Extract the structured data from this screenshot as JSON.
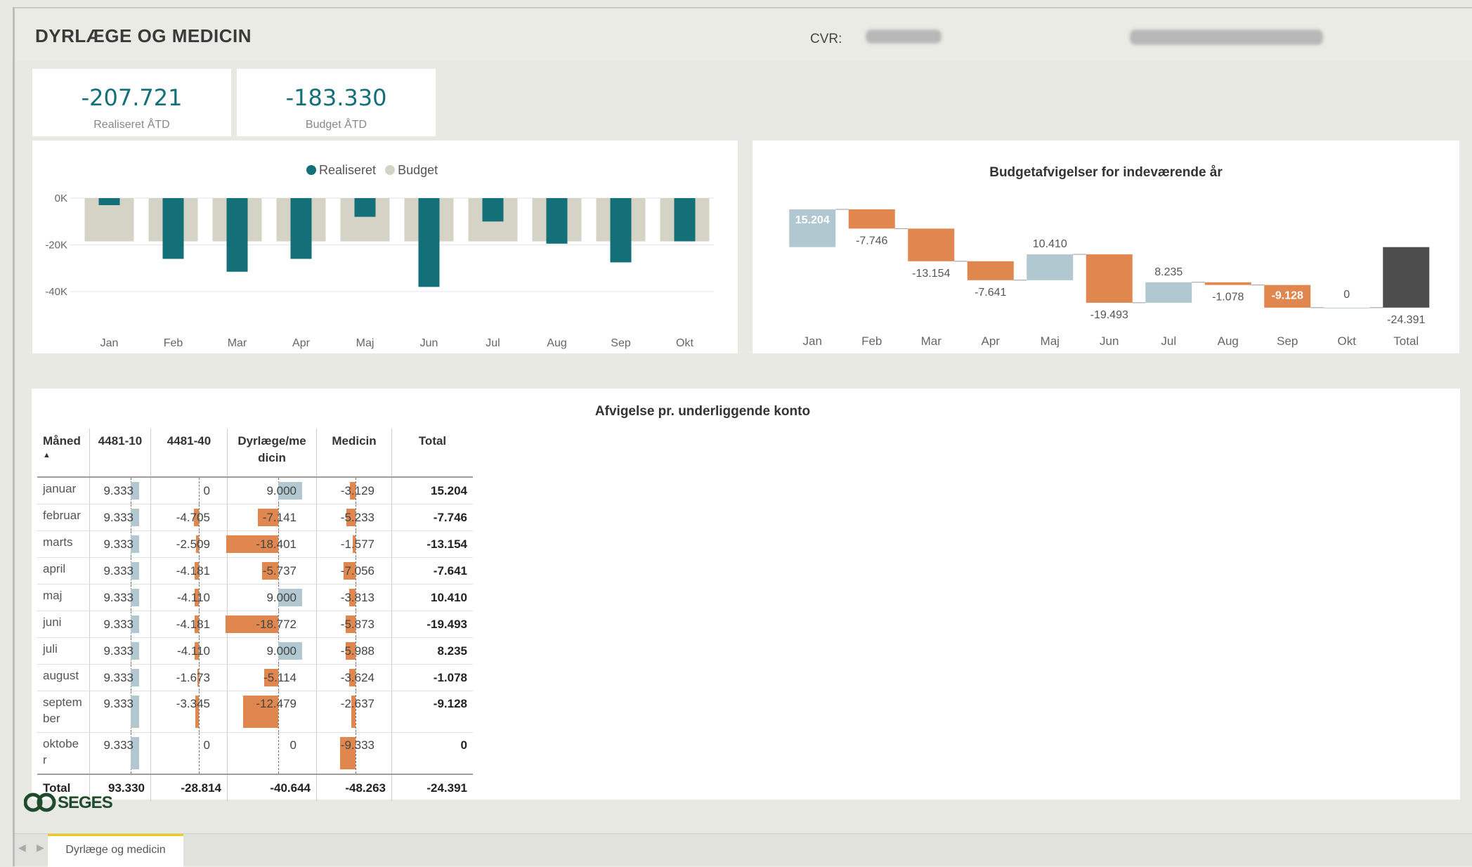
{
  "header": {
    "title": "DYRLÆGE OG MEDICIN",
    "cvr_label": "CVR:"
  },
  "kpis": [
    {
      "value": "-207.721",
      "label": "Realiseret ÅTD"
    },
    {
      "value": "-183.330",
      "label": "Budget ÅTD"
    }
  ],
  "bar_chart": {
    "legend": [
      "Realiseret",
      "Budget"
    ],
    "y_ticks": [
      "0K",
      "-20K",
      "-40K"
    ]
  },
  "waterfall": {
    "title": "Budgetafvigelser for indeværende år"
  },
  "matrix": {
    "title": "Afvigelse pr. underliggende konto",
    "headers": [
      "Måned",
      "4481-10",
      "4481-40",
      "Dyrlæge/me dicin",
      "Medicin",
      "Total"
    ],
    "sort_indicator": "▲",
    "rows": [
      {
        "month": "januar",
        "c1": "9.333",
        "c2": "0",
        "c3": "9.000",
        "c4": "-3.129",
        "total": "15.204"
      },
      {
        "month": "februar",
        "c1": "9.333",
        "c2": "-4.705",
        "c3": "-7.141",
        "c4": "-5.233",
        "total": "-7.746"
      },
      {
        "month": "marts",
        "c1": "9.333",
        "c2": "-2.509",
        "c3": "-18.401",
        "c4": "-1.577",
        "total": "-13.154"
      },
      {
        "month": "april",
        "c1": "9.333",
        "c2": "-4.181",
        "c3": "-5.737",
        "c4": "-7.056",
        "total": "-7.641"
      },
      {
        "month": "maj",
        "c1": "9.333",
        "c2": "-4.110",
        "c3": "9.000",
        "c4": "-3.813",
        "total": "10.410"
      },
      {
        "month": "juni",
        "c1": "9.333",
        "c2": "-4.181",
        "c3": "-18.772",
        "c4": "-5.873",
        "total": "-19.493"
      },
      {
        "month": "juli",
        "c1": "9.333",
        "c2": "-4.110",
        "c3": "9.000",
        "c4": "-5.988",
        "total": "8.235"
      },
      {
        "month": "august",
        "c1": "9.333",
        "c2": "-1.673",
        "c3": "-5.114",
        "c4": "-3.624",
        "total": "-1.078"
      },
      {
        "month": "septem ber",
        "c1": "9.333",
        "c2": "-3.345",
        "c3": "-12.479",
        "c4": "-2.637",
        "total": "-9.128"
      },
      {
        "month": "oktobe r",
        "c1": "9.333",
        "c2": "0",
        "c3": "0",
        "c4": "-9.333",
        "total": "0"
      }
    ],
    "total_row": {
      "month": "Total",
      "c1": "93.330",
      "c2": "-28.814",
      "c3": "-40.644",
      "c4": "-48.263",
      "total": "-24.391"
    }
  },
  "logo_text": "SEGES",
  "page_tab": "Dyrlæge og medicin",
  "colors": {
    "realiseret": "#136f78",
    "budget": "#d5d3c5",
    "positive": "#b2c8d1",
    "negative": "#e0874f",
    "total": "#4d4d4d",
    "tab_accent": "#f2c811"
  },
  "chart_data": [
    {
      "type": "bar",
      "categories": [
        "Jan",
        "Feb",
        "Mar",
        "Apr",
        "Maj",
        "Jun",
        "Jul",
        "Aug",
        "Sep",
        "Okt"
      ],
      "series": [
        {
          "name": "Realiseret",
          "values": [
            -3000,
            -26000,
            -31500,
            -26000,
            -8000,
            -38000,
            -10000,
            -19500,
            -27500,
            -18500
          ]
        },
        {
          "name": "Budget",
          "values": [
            -18500,
            -18500,
            -18500,
            -18500,
            -18500,
            -18500,
            -18500,
            -18500,
            -18500,
            -18500
          ]
        }
      ],
      "title": "",
      "xlabel": "",
      "ylabel": "",
      "y_tick_labels": [
        "0K",
        "-20K",
        "-40K"
      ],
      "ylim": [
        -40000,
        0
      ],
      "legend_position": "top-center",
      "grid": true
    },
    {
      "type": "bar",
      "subtype": "waterfall",
      "title": "Budgetafvigelser for indeværende år",
      "categories": [
        "Jan",
        "Feb",
        "Mar",
        "Apr",
        "Maj",
        "Jun",
        "Jul",
        "Aug",
        "Sep",
        "Okt",
        "Total"
      ],
      "values": [
        15204,
        -7746,
        -13154,
        -7641,
        10410,
        -19493,
        8235,
        -1078,
        -9128,
        0,
        -24391
      ],
      "data_labels": [
        "15.204",
        "-7.746",
        "-13.154",
        "-7.641",
        "10.410",
        "-19.493",
        "8.235",
        "-1.078",
        "-9.128",
        "0",
        "-24.391"
      ],
      "xlabel": "",
      "ylabel": ""
    }
  ]
}
